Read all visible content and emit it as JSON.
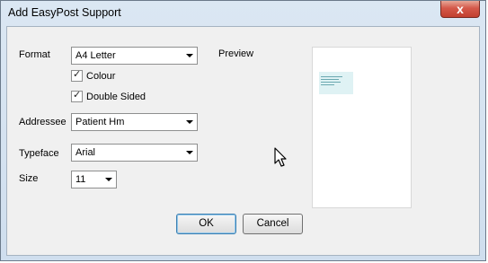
{
  "window": {
    "title": "Add EasyPost Support",
    "close_glyph": "x",
    "close_icon": "close-icon"
  },
  "form": {
    "format_label": "Format",
    "format_value": "A4 Letter",
    "colour_label": "Colour",
    "colour_checked": true,
    "double_sided_label": "Double Sided",
    "double_sided_checked": true,
    "addressee_label": "Addressee",
    "addressee_value": "Patient Hm",
    "typeface_label": "Typeface",
    "typeface_value": "Arial",
    "size_label": "Size",
    "size_value": "11",
    "preview_label": "Preview"
  },
  "buttons": {
    "ok": "OK",
    "cancel": "Cancel"
  },
  "colors": {
    "title_bar": "#cfdeee",
    "client_bg": "#f0f0f0",
    "close_red": "#c23f2f",
    "default_button_border": "#3c7fb1",
    "preview_address_block": "#dff2f4"
  }
}
